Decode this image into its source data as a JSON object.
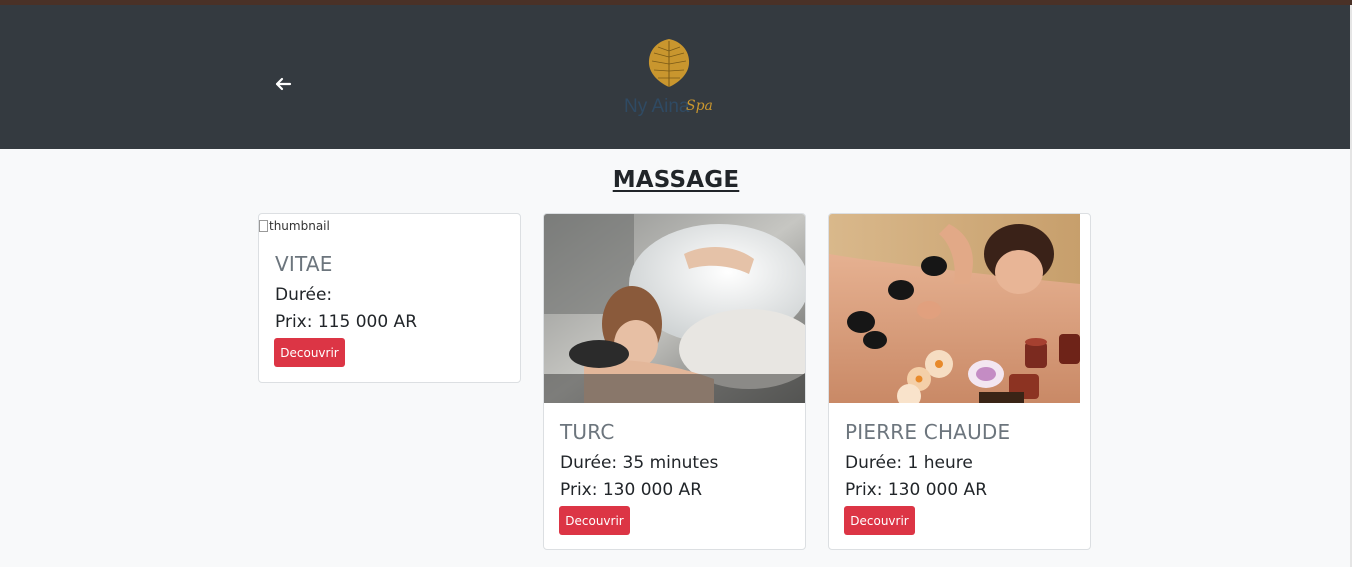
{
  "header": {
    "back_icon": "arrow-left-icon",
    "logo": {
      "brand_text": "Ny Aina",
      "script_text": "Spa",
      "gold": "#c9962e"
    }
  },
  "page": {
    "title": "MASSAGE"
  },
  "cards": [
    {
      "image_alt": "thumbnail",
      "name": "VITAE",
      "duration": "Durée:",
      "price": "Prix: 115 000 AR",
      "button": "Decouvrir"
    },
    {
      "image": "woman-lying-foam-massage",
      "name": "TURC",
      "duration": "Durée: 35 minutes",
      "price": "Prix: 130 000 AR",
      "button": "Decouvrir"
    },
    {
      "image": "hot-stone-back-massage",
      "name": "PIERRE CHAUDE",
      "duration": "Durée: 1 heure",
      "price": "Prix: 130 000 AR",
      "button": "Decouvrir"
    }
  ],
  "colors": {
    "header_bg": "#343a40",
    "page_bg": "#f8f9fa",
    "button_bg": "#dc3545",
    "card_title": "#6c757d"
  }
}
